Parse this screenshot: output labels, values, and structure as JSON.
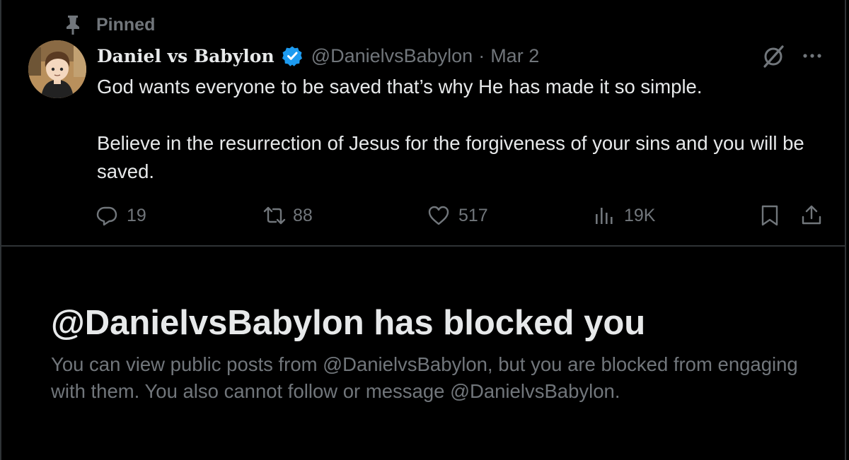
{
  "pinned": {
    "label": "Pinned",
    "icon": "pin-icon"
  },
  "author": {
    "display_name": "Daniel vs Babylon",
    "verified_icon": "verified-badge-icon",
    "verified_color": "#1d9bf0",
    "handle": "@DanielvsBabylon",
    "separator": "·",
    "date": "Mar 2"
  },
  "post": {
    "paragraphs": [
      "God wants everyone to be saved that’s why He has made it so simple.",
      "Believe in the resurrection of Jesus for the forgiveness of your sins and you will be saved."
    ]
  },
  "actions": {
    "reply": {
      "icon": "reply-icon",
      "count": "19"
    },
    "repost": {
      "icon": "repost-icon",
      "count": "88"
    },
    "like": {
      "icon": "heart-icon",
      "count": "517"
    },
    "views": {
      "icon": "views-icon",
      "count": "19K"
    },
    "bookmark": {
      "icon": "bookmark-icon"
    },
    "share": {
      "icon": "share-icon"
    }
  },
  "blocked_notice": {
    "title": "@DanielvsBabylon has blocked you",
    "description": "You can view public posts from @DanielvsBabylon, but you are blocked from engaging with them. You also cannot follow or message @DanielvsBabylon."
  },
  "colors": {
    "background": "#000000",
    "primary_text": "#e7e9ea",
    "secondary_text": "#71767b",
    "border": "#2f3336",
    "accent": "#1d9bf0"
  }
}
